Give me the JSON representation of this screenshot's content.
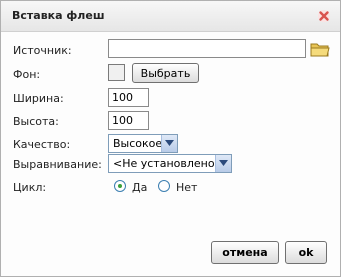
{
  "dialog": {
    "title": "Вставка флеш"
  },
  "form": {
    "source": {
      "label": "Источник:",
      "value": ""
    },
    "background": {
      "label": "Фон:",
      "swatch_color": "#f0f0f0",
      "choose_label": "Выбрать"
    },
    "width": {
      "label": "Ширина:",
      "value": "100"
    },
    "height": {
      "label": "Высота:",
      "value": "100"
    },
    "quality": {
      "label": "Качество:",
      "selected": "Высокое"
    },
    "align": {
      "label": "Выравнивание:",
      "selected": "<Не установлено>"
    },
    "loop": {
      "label": "Цикл:",
      "options": [
        {
          "label": "Да",
          "checked": true
        },
        {
          "label": "Нет",
          "checked": false
        }
      ]
    }
  },
  "footer": {
    "cancel_label": "отмена",
    "ok_label": "ok"
  },
  "icons": {
    "close": "close-icon",
    "browse": "folder-icon"
  },
  "colors": {
    "close_icon": "#d9534f",
    "radio_dot": "#3aa03a",
    "folder": "#e8c455"
  }
}
